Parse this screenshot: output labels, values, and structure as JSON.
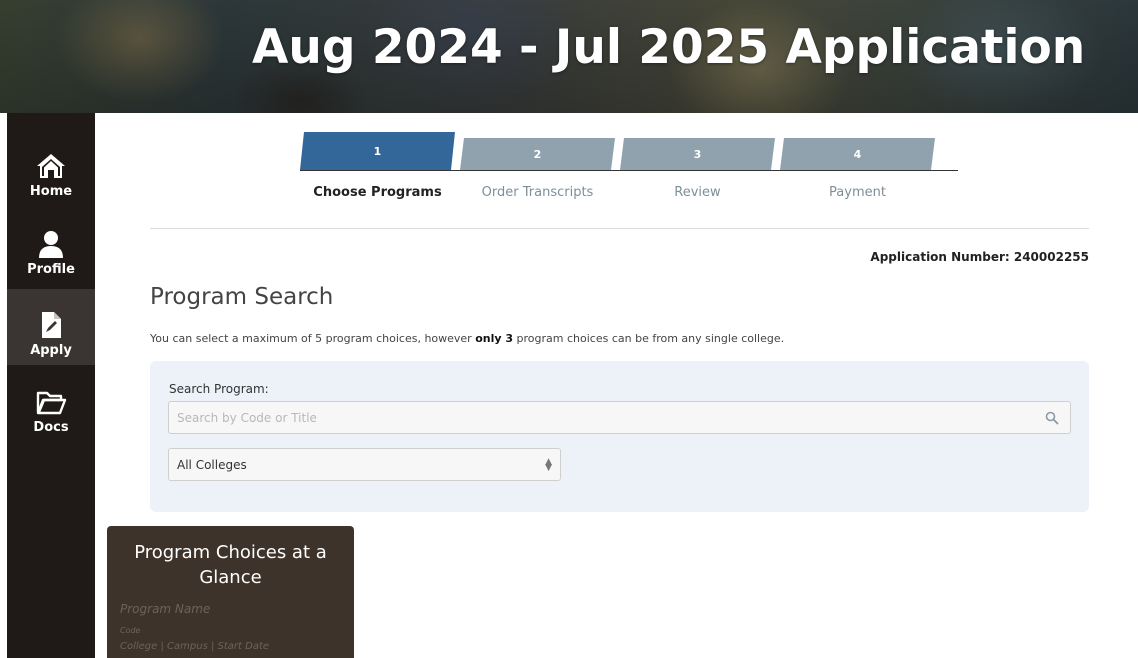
{
  "banner": {
    "title": "Aug 2024 - Jul 2025 Application"
  },
  "sidebar": {
    "items": [
      {
        "label": "Home",
        "icon": "home-icon",
        "active": false
      },
      {
        "label": "Profile",
        "icon": "user-icon",
        "active": false
      },
      {
        "label": "Apply",
        "icon": "document-edit-icon",
        "active": true
      },
      {
        "label": "Docs",
        "icon": "folder-open-icon",
        "active": false
      }
    ]
  },
  "steps": [
    {
      "number": "1",
      "label": "Choose Programs",
      "state": "current"
    },
    {
      "number": "2",
      "label": "Order Transcripts",
      "state": "pending"
    },
    {
      "number": "3",
      "label": "Review",
      "state": "pending"
    },
    {
      "number": "4",
      "label": "Payment",
      "state": "pending"
    }
  ],
  "application_number": "Application Number: 240002255",
  "program_search": {
    "title": "Program Search",
    "notice_prefix": "You can select a maximum of 5 program choices, however ",
    "notice_bold": "only 3",
    "notice_suffix": " program choices can be from any single college.",
    "search_label": "Search Program:",
    "search_placeholder": "Search by Code or Title",
    "search_value": "",
    "college_select_value": "All Colleges"
  },
  "glance": {
    "title": "Program Choices at a Glance",
    "program_name": "Program Name",
    "code": "Code",
    "meta": "College | Campus | Start Date"
  },
  "colors": {
    "sidebar_bg": "#1f1a17",
    "sidebar_active": "#3a3532",
    "step_current": "#336699",
    "step_pending": "#8fa2ad",
    "panel_bg": "#edf2f8",
    "glance_bg": "#3e332b"
  }
}
